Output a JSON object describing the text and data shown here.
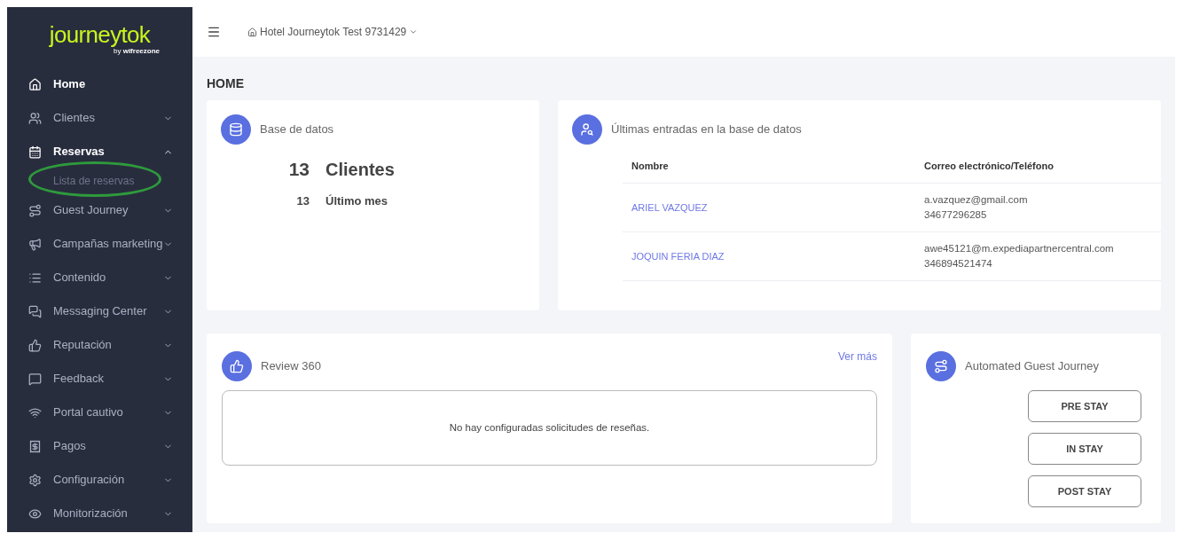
{
  "sidebar": {
    "logo": "journeytok",
    "logo_byline": "by",
    "logo_brand": "wifreezone",
    "items": [
      {
        "label": "Home",
        "kind": "link",
        "active": true
      },
      {
        "label": "Clientes",
        "kind": "group",
        "active": false,
        "expanded": false
      },
      {
        "label": "Reservas",
        "kind": "group",
        "active": true,
        "expanded": true,
        "children": [
          {
            "label": "Lista de reservas",
            "circled": true
          }
        ]
      },
      {
        "label": "Guest Journey",
        "kind": "group",
        "active": false,
        "expanded": false
      },
      {
        "label": "Campañas marketing",
        "kind": "group",
        "active": false,
        "expanded": false
      },
      {
        "label": "Contenido",
        "kind": "group",
        "active": false,
        "expanded": false
      },
      {
        "label": "Messaging Center",
        "kind": "group",
        "active": false,
        "expanded": false
      },
      {
        "label": "Reputación",
        "kind": "group",
        "active": false,
        "expanded": false
      },
      {
        "label": "Feedback",
        "kind": "group",
        "active": false,
        "expanded": false
      },
      {
        "label": "Portal cautivo",
        "kind": "group",
        "active": false,
        "expanded": false
      },
      {
        "label": "Pagos",
        "kind": "group",
        "active": false,
        "expanded": false
      },
      {
        "label": "Configuración",
        "kind": "group",
        "active": false,
        "expanded": false
      },
      {
        "label": "Monitorización",
        "kind": "group",
        "active": false,
        "expanded": false
      }
    ]
  },
  "topbar": {
    "hotel": "Hotel Journeytok Test 9731429"
  },
  "page_title": "HOME",
  "database": {
    "title": "Base de datos",
    "total": "13",
    "total_label": "Clientes",
    "month": "13",
    "month_label": "Último mes"
  },
  "latest": {
    "title": "Últimas entradas en la base de datos",
    "columns": [
      "Nombre",
      "Correo electrónico/Teléfono"
    ],
    "rows": [
      {
        "name": "ARIEL VAZQUEZ",
        "email": "a.vazquez@gmail.com",
        "phone": "34677296285"
      },
      {
        "name": "JOQUIN FERIA DIAZ",
        "email": "awe45121@m.expediapartnercentral.com",
        "phone": "346894521474"
      }
    ]
  },
  "review": {
    "title": "Review 360",
    "link": "Ver más",
    "empty": "No hay configuradas solicitudes de reseñas."
  },
  "journey": {
    "title": "Automated Guest Journey",
    "buttons": [
      "PRE STAY",
      "IN STAY",
      "POST STAY"
    ]
  }
}
